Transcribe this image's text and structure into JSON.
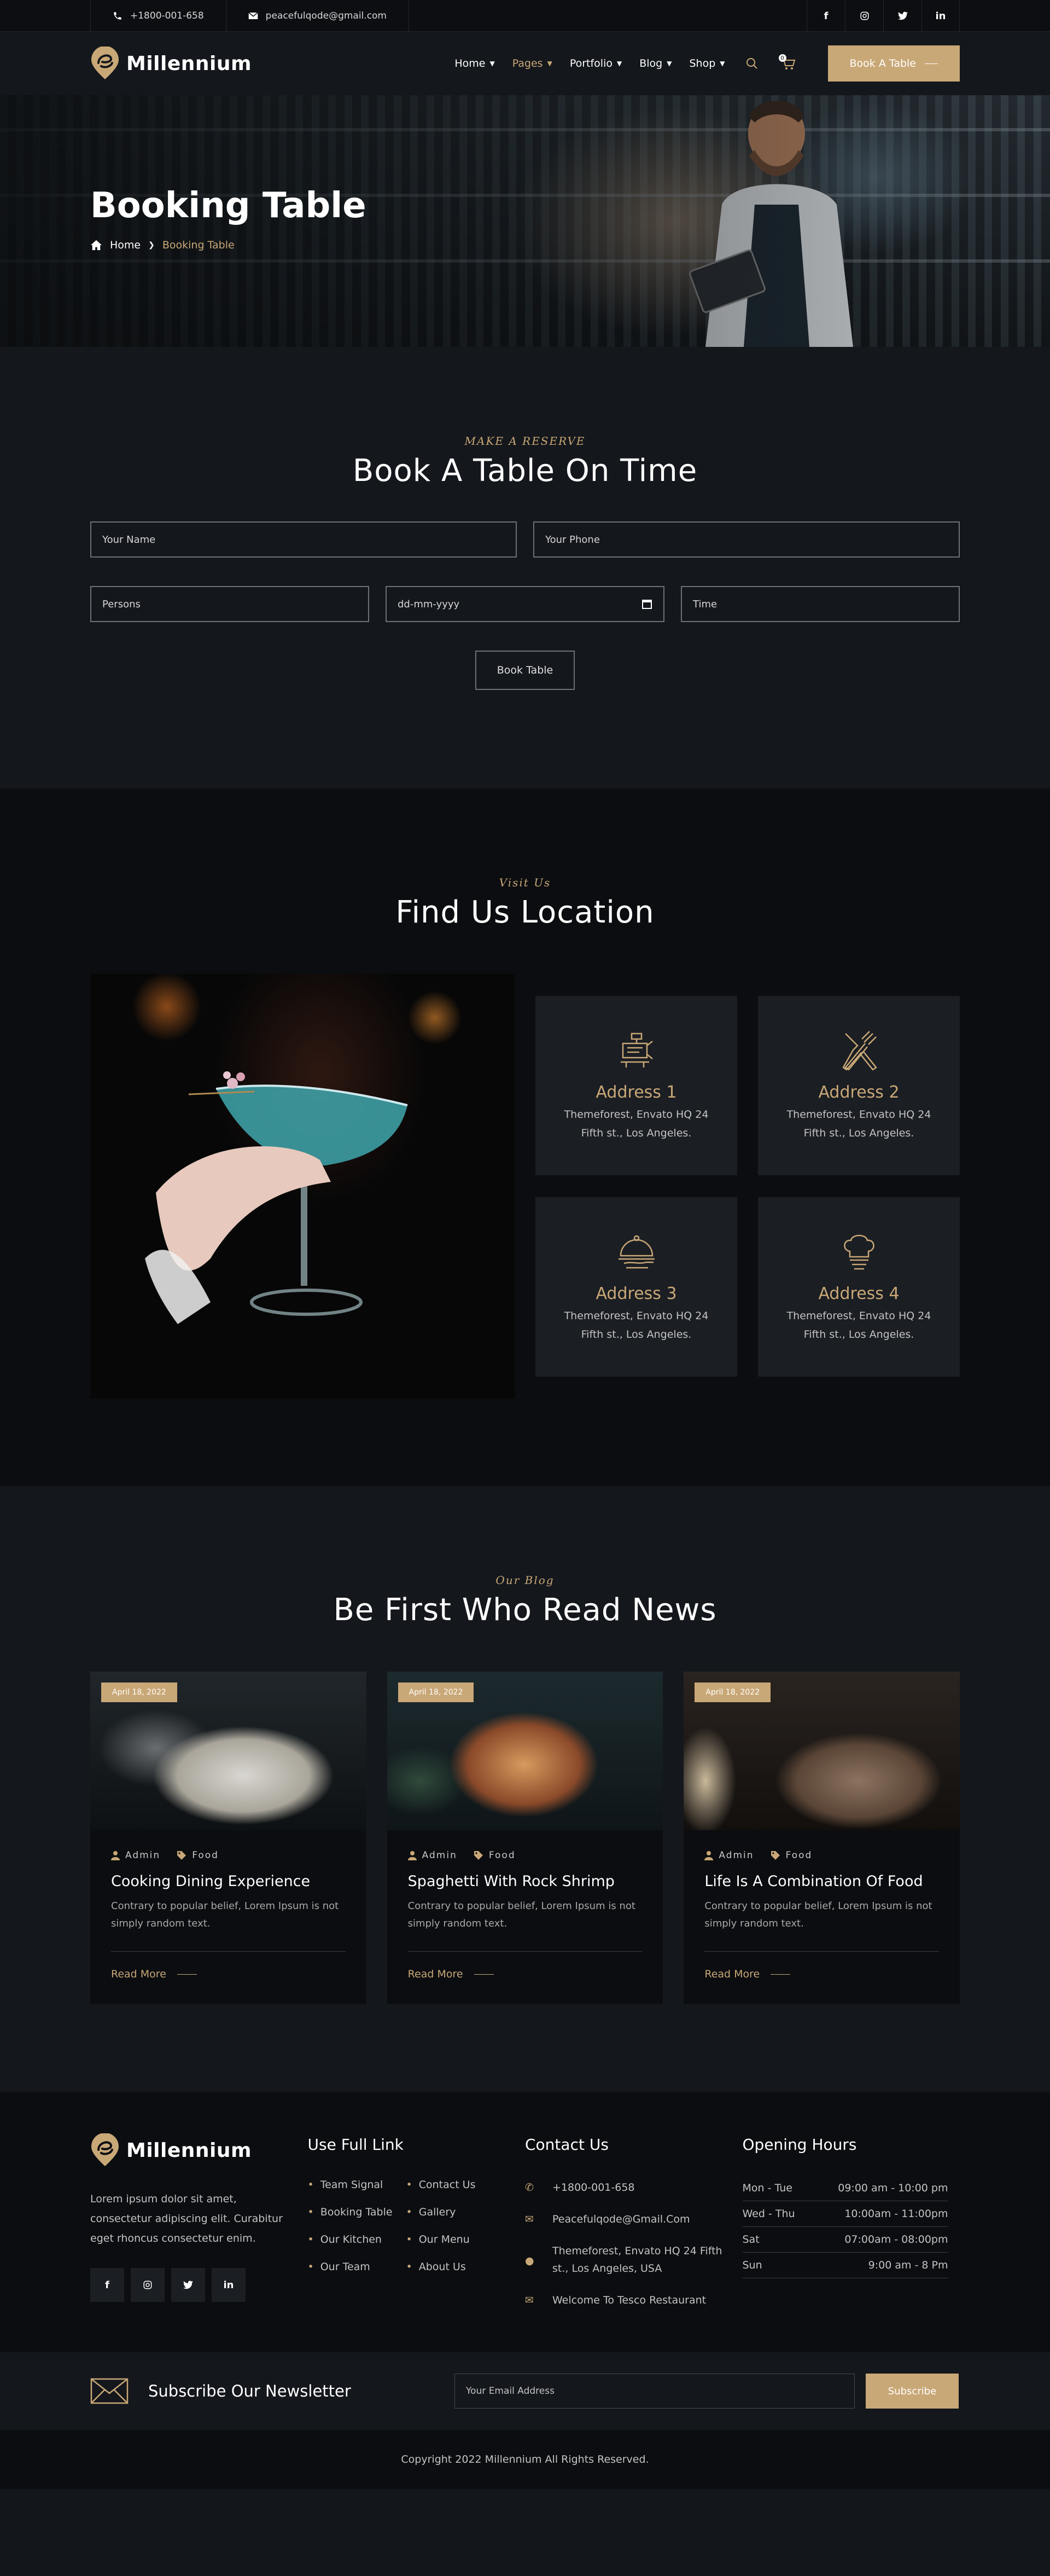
{
  "topbar": {
    "phone": "+1800-001-658",
    "email": "peacefulqode@gmail.com",
    "socials": [
      "facebook-icon",
      "instagram-icon",
      "twitter-icon",
      "linkedin-icon"
    ]
  },
  "header": {
    "brand": "Millennium",
    "nav": [
      {
        "label": "Home",
        "active": false
      },
      {
        "label": "Pages",
        "active": true
      },
      {
        "label": "Portfolio",
        "active": false
      },
      {
        "label": "Blog",
        "active": false
      },
      {
        "label": "Shop",
        "active": false
      }
    ],
    "cart_count": "0",
    "cta": "Book A Table"
  },
  "hero": {
    "title": "Booking Table",
    "crumb_home": "Home",
    "crumb_current": "Booking Table"
  },
  "booking": {
    "subtitle": "MAKE A RESERVE",
    "title": "Book A Table On Time",
    "fields": {
      "name": "Your Name",
      "phone": "Your Phone",
      "persons": "Persons",
      "date": "dd-mm-yyyy",
      "time": "Time"
    },
    "button": "Book Table"
  },
  "location": {
    "subtitle": "Visit Us",
    "title": "Find Us Location",
    "cards": [
      {
        "title": "Address 1",
        "text": "Themeforest, Envato HQ 24 Fifth st., Los Angeles.",
        "icon": "restaurant-sign-icon"
      },
      {
        "title": "Address 2",
        "text": "Themeforest, Envato HQ 24 Fifth st., Los Angeles.",
        "icon": "fork-knife-icon"
      },
      {
        "title": "Address 3",
        "text": "Themeforest, Envato HQ 24 Fifth st., Los Angeles.",
        "icon": "food-tray-icon"
      },
      {
        "title": "Address 4",
        "text": "Themeforest, Envato HQ 24 Fifth st., Los Angeles.",
        "icon": "chef-hat-icon"
      }
    ]
  },
  "news": {
    "subtitle": "Our Blog",
    "title": "Be First Who Read News",
    "posts": [
      {
        "date": "April 18, 2022",
        "author": "Admin",
        "category": "Food",
        "title": "Cooking Dining Experience",
        "text": "Contrary to popular belief, Lorem Ipsum is not simply random text.",
        "more": "Read More"
      },
      {
        "date": "April 18, 2022",
        "author": "Admin",
        "category": "Food",
        "title": "Spaghetti With Rock Shrimp",
        "text": "Contrary to popular belief, Lorem Ipsum is not simply random text.",
        "more": "Read More"
      },
      {
        "date": "April 18, 2022",
        "author": "Admin",
        "category": "Food",
        "title": "Life Is A Combination Of Food",
        "text": "Contrary to popular belief, Lorem Ipsum is not simply random text.",
        "more": "Read More"
      }
    ]
  },
  "footer": {
    "brand": "Millennium",
    "desc": "Lorem ipsum dolor sit amet, consectetur adipiscing elit. Curabitur eget rhoncus consectetur enim.",
    "links_title": "Use Full Link",
    "links": [
      "Team Signal",
      "Contact Us",
      "Booking Table",
      "Gallery",
      "Our Kitchen",
      "Our Menu",
      "Our Team",
      "About Us"
    ],
    "contact_title": "Contact Us",
    "contact": {
      "phone": "+1800-001-658",
      "email": "Peacefulqode@Gmail.Com",
      "address": "Themeforest, Envato HQ 24 Fifth st., Los Angeles, USA",
      "welcome": "Welcome To Tesco Restaurant"
    },
    "hours_title": "Opening Hours",
    "hours": [
      {
        "day": "Mon - Tue",
        "time": "09:00 am - 10:00 pm"
      },
      {
        "day": "Wed - Thu",
        "time": "10:00am - 11:00pm"
      },
      {
        "day": "Sat",
        "time": "07:00am - 08:00pm"
      },
      {
        "day": "Sun",
        "time": "9:00 am - 8 Pm"
      }
    ]
  },
  "newsletter": {
    "title": "Subscribe Our Newsletter",
    "placeholder": "Your Email Address",
    "button": "Subscribe"
  },
  "copyright": "Copyright 2022 Millennium All Rights Reserved.",
  "colors": {
    "accent": "#c9a877",
    "bg_dark": "#0b0d10",
    "bg": "#14171c"
  }
}
